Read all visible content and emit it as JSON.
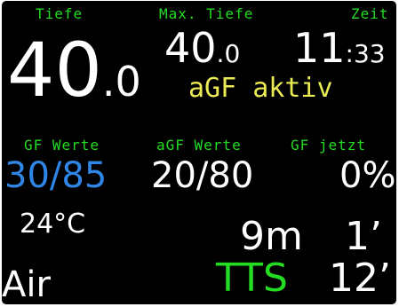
{
  "labels": {
    "depth": "Tiefe",
    "max_depth": "Max. Tiefe",
    "time": "Zeit",
    "gf_values": "GF Werte",
    "agf_values": "aGF Werte",
    "gf_now": "GF jetzt"
  },
  "depth": {
    "integer": "40",
    "decimal": ".0"
  },
  "max_depth": {
    "integer": "40",
    "decimal": ".0"
  },
  "dive_time": {
    "minutes": "11",
    "seconds": ":33"
  },
  "agf_status": "aGF aktiv",
  "gf": {
    "values": "30/85",
    "agf_values": "20/80",
    "current": "0%"
  },
  "temperature": "24°C",
  "stop": {
    "depth": "9m",
    "time": "1’"
  },
  "tts": {
    "label": "TTS",
    "value": "12’"
  },
  "gas": "Air",
  "colors": {
    "label": "#22dd22",
    "highlight": "#eaea55",
    "gf_active": "#2f86e6",
    "background": "#000000"
  }
}
